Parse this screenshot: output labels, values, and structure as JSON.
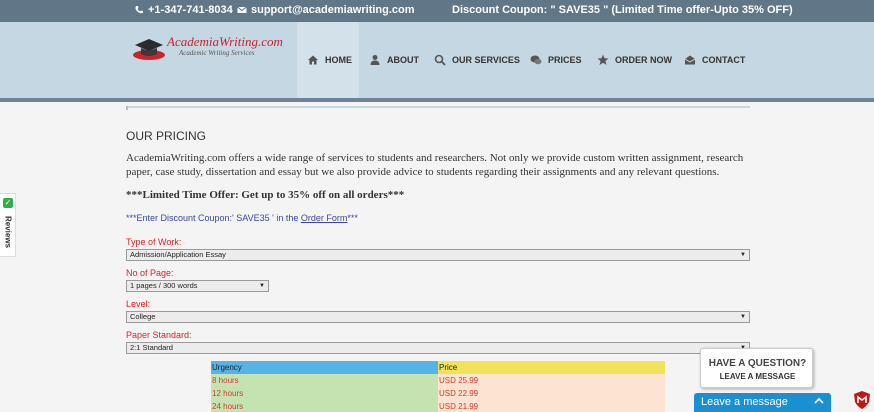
{
  "topbar": {
    "phone": "+1-347-741-8034",
    "email": "support@academiawriting.com",
    "coupon": "Discount Coupon: \" SAVE35 \" (Limited Time offer-Upto 35% OFF)"
  },
  "logo": {
    "name": "AcademiaWriting.com",
    "tagline": "Academic Writing Services"
  },
  "nav": [
    {
      "label": "HOME",
      "icon": "home-icon"
    },
    {
      "label": "ABOUT",
      "icon": "user-icon"
    },
    {
      "label": "OUR SERVICES",
      "icon": "search-icon"
    },
    {
      "label": "PRICES",
      "icon": "chat-icon"
    },
    {
      "label": "ORDER NOW",
      "icon": "star-icon"
    },
    {
      "label": "CONTACT",
      "icon": "envelope-icon"
    }
  ],
  "page": {
    "title": "OUR PRICING",
    "intro": "AcademiaWriting.com offers a wide range of services to students and researchers. Not only we provide custom written assignment, research paper, case study, dissertation and essay but we also provide advice to students regarding their assignments and any relevant questions.",
    "offer": "***Limited Time Offer: Get up to 35% off on all orders***",
    "coupon_prefix": "***Enter Discount Coupon:' SAVE35 ' in the ",
    "coupon_link": "Order Form",
    "coupon_suffix": "***"
  },
  "form": {
    "type_label": "Type of Work:",
    "type_value": "Admission/Application Essay",
    "pages_label": "No of Page:",
    "pages_value": "1 pages / 300 words",
    "level_label": "Level:",
    "level_value": "College",
    "standard_label": "Paper Standard:",
    "standard_value": "2:1 Standard"
  },
  "table": {
    "headers": [
      "Urgency",
      "Price"
    ],
    "rows": [
      [
        "8 hours",
        "USD 25.99"
      ],
      [
        "12 hours",
        "USD 22.99"
      ],
      [
        "24 hours",
        "USD 21.99"
      ]
    ]
  },
  "reviews": {
    "label": "Reviews"
  },
  "chat": {
    "question": "HAVE A QUESTION?",
    "leave_prompt": "LEAVE A MESSAGE",
    "bar": "Leave a message"
  },
  "colors": {
    "topbar": "#617787",
    "header": "#c4d7e3",
    "label_red": "#dd2222",
    "link_blue": "#3b45a8",
    "chat_blue": "#1a8fd1"
  }
}
